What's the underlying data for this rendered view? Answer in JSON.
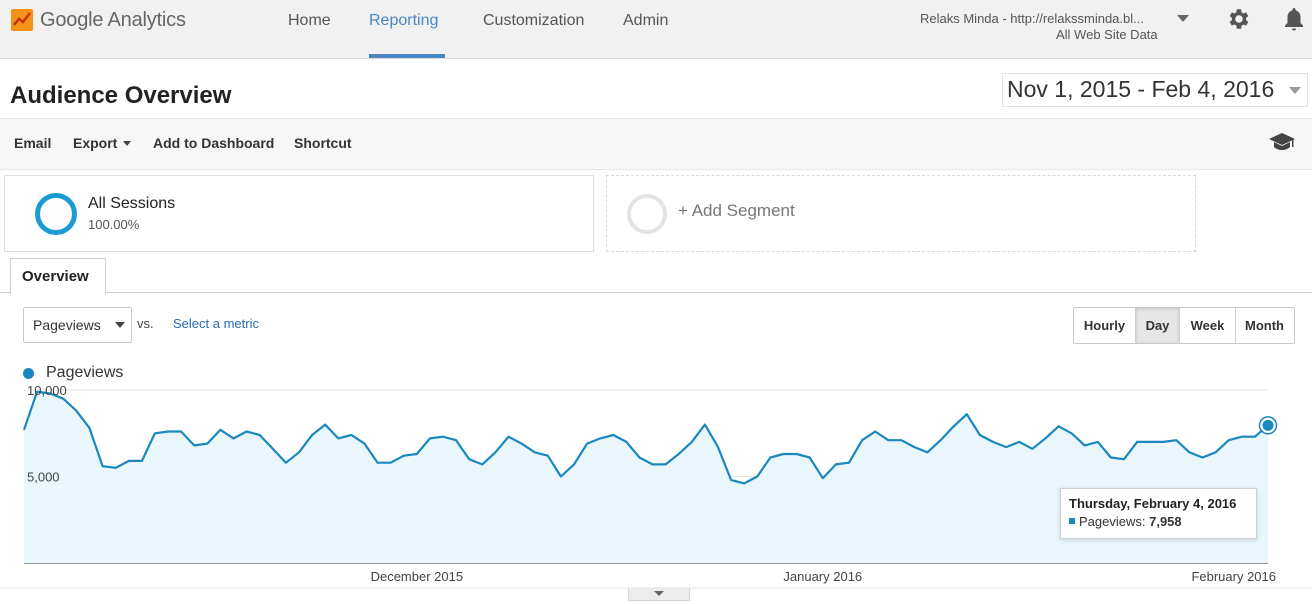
{
  "header": {
    "product": "Google Analytics",
    "nav": [
      "Home",
      "Reporting",
      "Customization",
      "Admin"
    ],
    "active_nav": "Reporting",
    "account_name": "Relaks Minda - http://relakssminda.bl...",
    "account_view": "All Web Site Data"
  },
  "page": {
    "title": "Audience Overview",
    "date_range": "Nov 1, 2015 - Feb 4, 2016"
  },
  "actions": {
    "email": "Email",
    "export": "Export",
    "add_to_dashboard": "Add to Dashboard",
    "shortcut": "Shortcut"
  },
  "segments": {
    "all_label": "All Sessions",
    "all_pct": "100.00%",
    "add_label": "+ Add Segment"
  },
  "tabs": {
    "overview": "Overview"
  },
  "controls": {
    "metric": "Pageviews",
    "vs": "vs.",
    "select_metric": "Select a metric",
    "granularity": [
      "Hourly",
      "Day",
      "Week",
      "Month"
    ],
    "active_granularity": "Day"
  },
  "legend": {
    "series": "Pageviews"
  },
  "tooltip": {
    "date": "Thursday, February 4, 2016",
    "metric": "Pageviews:",
    "value": "7,958"
  },
  "colors": {
    "accent": "#4a86c5",
    "series": "#1a87bf",
    "area": "#e9f6fc"
  },
  "chart_data": {
    "type": "area",
    "ylim": [
      0,
      10000
    ],
    "yticks": [
      "5,000",
      "10,000"
    ],
    "ytick_values": [
      5000,
      10000
    ],
    "xticks": [
      "December 2015",
      "January 2016",
      "February 2016"
    ],
    "xtick_dates": [
      "2015-12-01",
      "2016-01-01",
      "2016-02-01"
    ],
    "series": [
      {
        "name": "Pageviews",
        "dates": [
          "2015-11-01",
          "2015-11-02",
          "2015-11-03",
          "2015-11-04",
          "2015-11-05",
          "2015-11-06",
          "2015-11-07",
          "2015-11-08",
          "2015-11-09",
          "2015-11-10",
          "2015-11-11",
          "2015-11-12",
          "2015-11-13",
          "2015-11-14",
          "2015-11-15",
          "2015-11-16",
          "2015-11-17",
          "2015-11-18",
          "2015-11-19",
          "2015-11-20",
          "2015-11-21",
          "2015-11-22",
          "2015-11-23",
          "2015-11-24",
          "2015-11-25",
          "2015-11-26",
          "2015-11-27",
          "2015-11-28",
          "2015-11-29",
          "2015-11-30",
          "2015-12-01",
          "2015-12-02",
          "2015-12-03",
          "2015-12-04",
          "2015-12-05",
          "2015-12-06",
          "2015-12-07",
          "2015-12-08",
          "2015-12-09",
          "2015-12-10",
          "2015-12-11",
          "2015-12-12",
          "2015-12-13",
          "2015-12-14",
          "2015-12-15",
          "2015-12-16",
          "2015-12-17",
          "2015-12-18",
          "2015-12-19",
          "2015-12-20",
          "2015-12-21",
          "2015-12-22",
          "2015-12-23",
          "2015-12-24",
          "2015-12-25",
          "2015-12-26",
          "2015-12-27",
          "2015-12-28",
          "2015-12-29",
          "2015-12-30",
          "2015-12-31",
          "2016-01-01",
          "2016-01-02",
          "2016-01-03",
          "2016-01-04",
          "2016-01-05",
          "2016-01-06",
          "2016-01-07",
          "2016-01-08",
          "2016-01-09",
          "2016-01-10",
          "2016-01-11",
          "2016-01-12",
          "2016-01-13",
          "2016-01-14",
          "2016-01-15",
          "2016-01-16",
          "2016-01-17",
          "2016-01-18",
          "2016-01-19",
          "2016-01-20",
          "2016-01-21",
          "2016-01-22",
          "2016-01-23",
          "2016-01-24",
          "2016-01-25",
          "2016-01-26",
          "2016-01-27",
          "2016-01-28",
          "2016-01-29",
          "2016-01-30",
          "2016-01-31",
          "2016-02-01",
          "2016-02-02",
          "2016-02-03",
          "2016-02-04"
        ],
        "values": [
          7700,
          9900,
          9800,
          9500,
          8800,
          7800,
          5600,
          5500,
          5900,
          5900,
          7500,
          7600,
          7600,
          6800,
          6900,
          7700,
          7200,
          7600,
          7400,
          6600,
          5800,
          6400,
          7400,
          8000,
          7200,
          7400,
          6900,
          5800,
          5800,
          6200,
          6300,
          7200,
          7300,
          7100,
          6000,
          5700,
          6400,
          7300,
          6900,
          6400,
          6200,
          5000,
          5700,
          6900,
          7200,
          7400,
          7000,
          6100,
          5700,
          5700,
          6300,
          7000,
          8000,
          6700,
          4800,
          4600,
          5000,
          6100,
          6300,
          6300,
          6100,
          4900,
          5700,
          5800,
          7100,
          7600,
          7100,
          7100,
          6700,
          6400,
          7100,
          7900,
          8600,
          7400,
          7000,
          6700,
          7000,
          6600,
          7200,
          7900,
          7500,
          6800,
          7000,
          6100,
          6000,
          7000,
          7000,
          7000,
          7100,
          6400,
          6100,
          6400,
          7100,
          7300,
          7300,
          7958
        ]
      }
    ]
  }
}
